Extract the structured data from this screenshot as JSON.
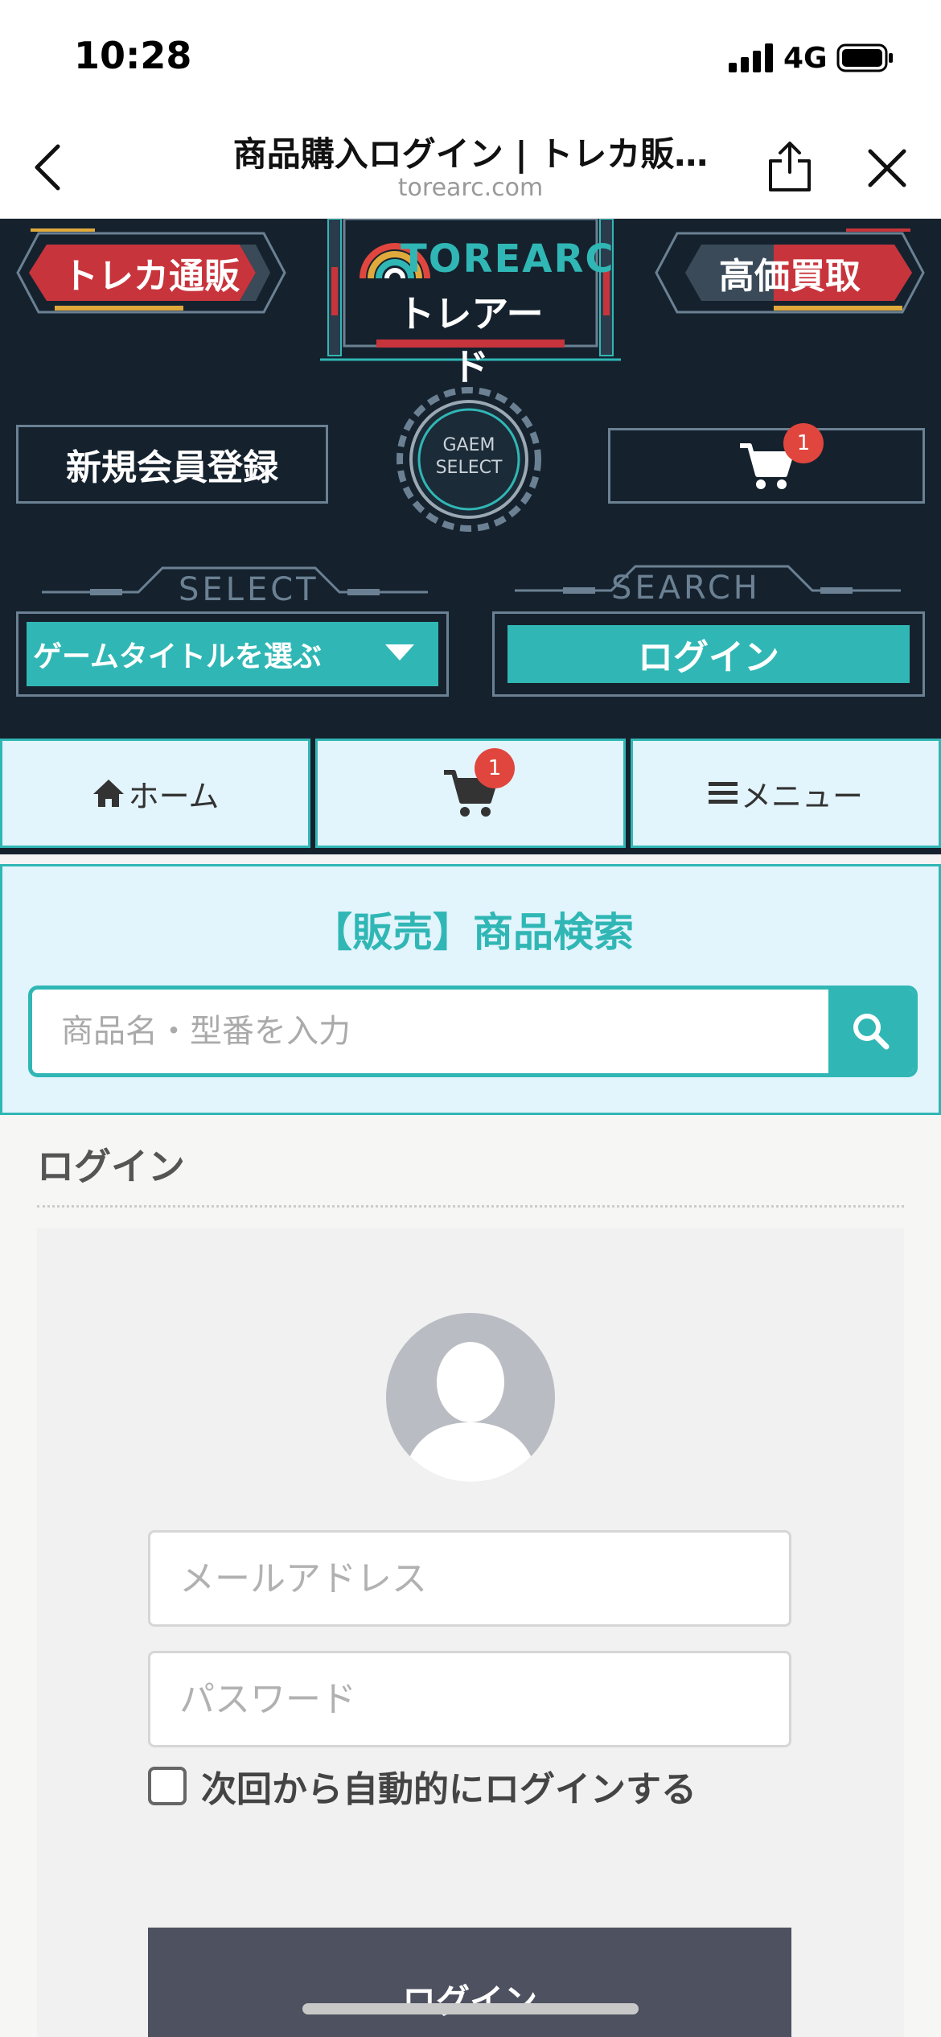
{
  "status_bar": {
    "time": "10:28",
    "network": "4G"
  },
  "browser": {
    "title": "商品購入ログイン | トレカ販…",
    "url": "torearc.com"
  },
  "hero": {
    "badge_left": "トレカ通販",
    "badge_right": "高価買取",
    "brand": "TOREARC",
    "brand_jp": "トレアード",
    "register_label": "新規会員登録",
    "gear_line1": "GAEM",
    "gear_line2": "SELECT",
    "cart_count": "1",
    "select_label": "SELECT",
    "search_label": "SEARCH",
    "game_select": "ゲームタイトルを選ぶ",
    "login_label": "ログイン"
  },
  "nav": {
    "home": "ホーム",
    "cart_count": "1",
    "menu": "メニュー"
  },
  "search": {
    "title": "【販売】商品検索",
    "placeholder": "商品名・型番を入力"
  },
  "login": {
    "heading": "ログイン",
    "email_placeholder": "メールアドレス",
    "password_placeholder": "パスワード",
    "remember": "次回から自動的にログインする",
    "submit": "ログイン"
  },
  "colors": {
    "accent": "#30b7b5",
    "hero_bg": "#15222e",
    "badge_red": "#c8343c",
    "cart_badge": "#e0463e",
    "nav_bg": "#e2f4fc"
  }
}
